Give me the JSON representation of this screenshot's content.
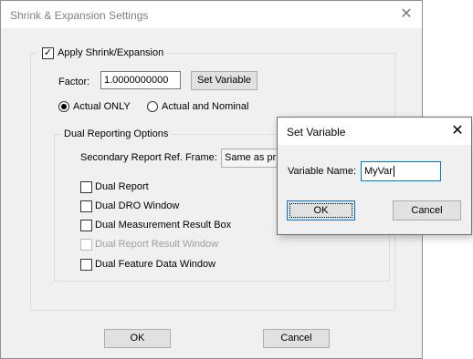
{
  "main_dialog": {
    "title": "Shrink & Expansion Settings",
    "close_glyph": "✕",
    "apply_checkbox": {
      "label": "Apply Shrink/Expansion",
      "checked": true
    },
    "factor": {
      "label": "Factor:",
      "value": "1.0000000000",
      "set_variable_label": "Set Variable"
    },
    "radios": [
      {
        "label": "Actual ONLY",
        "selected": true
      },
      {
        "label": "Actual and Nominal",
        "selected": false
      }
    ],
    "dual_reporting": {
      "legend": "Dual Reporting Options",
      "secondary_frame_label": "Secondary Report Ref. Frame:",
      "secondary_frame_value": "Same as pri",
      "checkboxes": [
        {
          "label": "Dual Report",
          "checked": false,
          "enabled": true
        },
        {
          "label": "Dual DRO Window",
          "checked": false,
          "enabled": true
        },
        {
          "label": "Dual Measurement Result Box",
          "checked": false,
          "enabled": true
        },
        {
          "label": "Dual Report Result Window",
          "checked": false,
          "enabled": false
        },
        {
          "label": "Dual Feature Data Window",
          "checked": false,
          "enabled": true
        }
      ]
    },
    "ok_label": "OK",
    "cancel_label": "Cancel"
  },
  "set_variable_dialog": {
    "title": "Set Variable",
    "close_glyph": "✕",
    "variable_name_label": "Variable Name:",
    "variable_name_value": "MyVar",
    "ok_label": "OK",
    "cancel_label": "Cancel"
  },
  "icons": {
    "checkmark": "✓"
  }
}
